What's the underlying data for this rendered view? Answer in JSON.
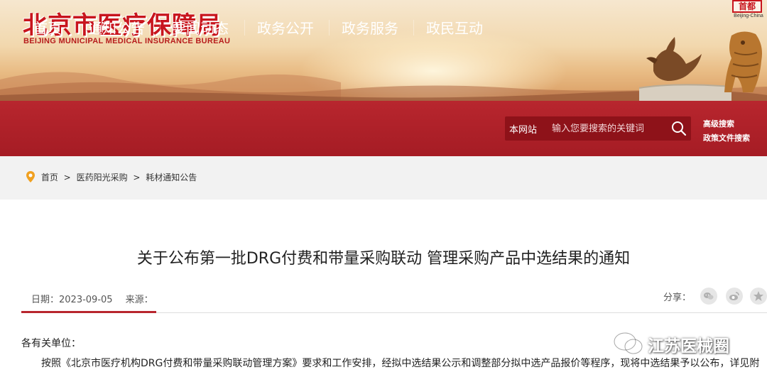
{
  "header": {
    "logo_cn": "北京市医疗保障局",
    "logo_en": "BEIJING MUNICIPAL MEDICAL INSURANCE BUREAU",
    "seal_glyph": "首都",
    "seal_caption": "Beijing-China"
  },
  "nav": {
    "items": [
      "首页",
      "通知公告",
      "要闻动态",
      "政务公开",
      "政务服务",
      "政民互动"
    ],
    "search_scope": "本网站",
    "search_placeholder": "输入您要搜索的关键词",
    "advanced_search": "高级搜索",
    "policy_search": "政策文件搜索"
  },
  "breadcrumb": {
    "items": [
      "首页",
      "医药阳光采购",
      "耗材通知公告"
    ],
    "separator": ">"
  },
  "article": {
    "title": "关于公布第一批DRG付费和带量采购联动 管理采购产品中选结果的通知",
    "date_label": "日期：2023-09-05",
    "source_label": "来源：",
    "share_label": "分享：",
    "addressee": "各有关单位：",
    "paragraph": "按照《北京市医疗机构DRG付费和带量采购联动管理方案》要求和工作安排，经拟中选结果公示和调整部分拟中选产品报价等程序，现将中选结果予以公布，详见附"
  },
  "watermark": {
    "text": "江苏医械圈"
  },
  "colors": {
    "brand_red": "#b8262e",
    "title_red": "#c8151d",
    "search_bg": "#8e1219"
  },
  "icons": {
    "search": "search-icon",
    "location": "location-pin-icon",
    "wechat": "wechat-icon",
    "weibo": "weibo-icon",
    "qzone": "qzone-star-icon"
  }
}
